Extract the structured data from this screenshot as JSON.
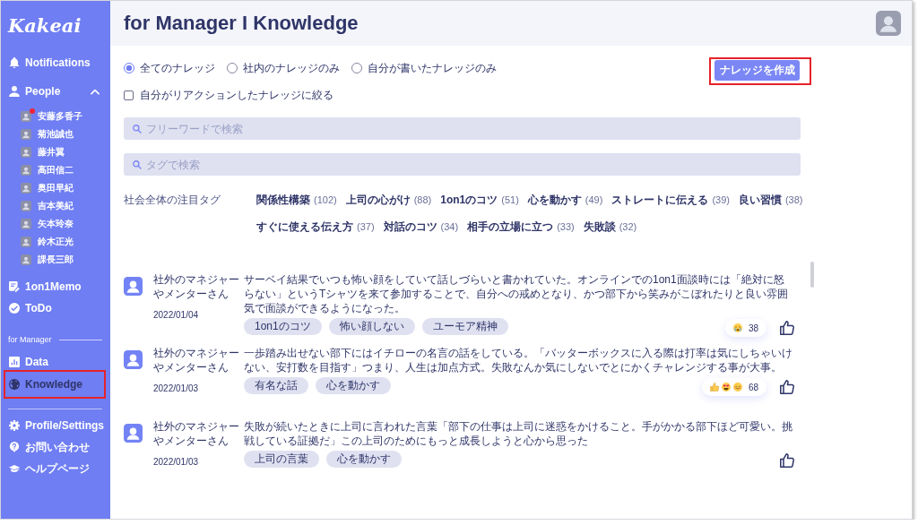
{
  "sidebar": {
    "logo": "Kakeai",
    "nav": [
      {
        "label": "Notifications",
        "selected": false
      }
    ],
    "people": {
      "label": "People",
      "expanded": true,
      "members": [
        {
          "name": "安藤多香子",
          "unread": true
        },
        {
          "name": "菊池誠也",
          "unread": false
        },
        {
          "name": "藤井翼",
          "unread": false
        },
        {
          "name": "高田信二",
          "unread": false
        },
        {
          "name": "奥田早紀",
          "unread": false
        },
        {
          "name": "吉本美紀",
          "unread": false
        },
        {
          "name": "矢本玲奈",
          "unread": false
        },
        {
          "name": "鈴木正光",
          "unread": false
        },
        {
          "name": "課長三郎",
          "unread": false
        }
      ]
    },
    "nav_after": [
      {
        "label": "1on1Memo",
        "selected": false
      },
      {
        "label": "ToDo",
        "selected": false
      }
    ],
    "manager_section": {
      "title": "for Manager",
      "items": [
        {
          "label": "Data",
          "selected": false,
          "annotated": false
        },
        {
          "label": "Knowledge",
          "selected": true,
          "annotated": true
        }
      ]
    },
    "footer_nav": [
      {
        "label": "Profile/Settings",
        "selected": false
      },
      {
        "label": "お問い合わせ",
        "selected": false
      },
      {
        "label": "ヘルプページ",
        "selected": false
      }
    ]
  },
  "header": {
    "title": "for Manager I Knowledge"
  },
  "filters": {
    "scope": [
      {
        "label": "全てのナレッジ",
        "selected": true
      },
      {
        "label": "社内のナレッジのみ",
        "selected": false
      },
      {
        "label": "自分が書いたナレッジのみ",
        "selected": false
      }
    ],
    "reacted_only": {
      "label": "自分がリアクションしたナレッジに絞る",
      "checked": false
    }
  },
  "create_button": {
    "label": "ナレッジを作成",
    "annotated": true
  },
  "search_fields": [
    {
      "placeholder": "フリーワードで検索"
    },
    {
      "placeholder": "タグで検索"
    }
  ],
  "trending_tags": {
    "label": "社会全体の注目タグ",
    "tags": [
      {
        "name": "関係性構築",
        "count": "(102)"
      },
      {
        "name": "上司の心がけ",
        "count": "(88)"
      },
      {
        "name": "1on1のコツ",
        "count": "(51)"
      },
      {
        "name": "心を動かす",
        "count": "(49)"
      },
      {
        "name": "ストレートに伝える",
        "count": "(39)"
      },
      {
        "name": "良い習慣",
        "count": "(38)"
      },
      {
        "name": "すぐに使える伝え方",
        "count": "(37)"
      },
      {
        "name": "対話のコツ",
        "count": "(34)"
      },
      {
        "name": "相手の立場に立つ",
        "count": "(33)"
      },
      {
        "name": "失敗談",
        "count": "(32)"
      }
    ]
  },
  "knowledge_list": [
    {
      "author": "社外のマネジャーやメンターさん",
      "date": "2022/01/04",
      "text": "サーベイ結果でいつも怖い顔をしていて話しづらいと書かれていた。オンラインでの1on1面談時には「絶対に怒らない」というTシャツを来て参加することで、自分への戒めとなり、かつ部下から笑みがこぼれたりと良い雰囲気で面談ができるようになった。",
      "tags": [
        "1on1のコツ",
        "怖い顔しない",
        "ユーモア精神"
      ],
      "reactions": {
        "emojis": [
          {
            "kind": "crying"
          }
        ],
        "count": "38"
      },
      "liked": false
    },
    {
      "author": "社外のマネジャーやメンターさん",
      "date": "2022/01/03",
      "text": "一歩踏み出せない部下にはイチローの名言の話をしている。「バッターボックスに入る際は打率は気にしちゃいけない、安打数を目指す」つまり、人生は加点方式。失敗なんか気にしないでとにかくチャレンジする事が大事。",
      "tags": [
        "有名な話",
        "心を動かす"
      ],
      "reactions": {
        "emojis": [
          {
            "kind": "thumbs-up"
          },
          {
            "kind": "heart-eyes"
          },
          {
            "kind": "smile"
          }
        ],
        "count": "68"
      },
      "liked": false
    },
    {
      "author": "社外のマネジャーやメンターさん",
      "date": "2022/01/03",
      "text": "失敗が続いたときに上司に言われた言葉「部下の仕事は上司に迷惑をかけること。手がかかる部下ほど可愛い。挑戦している証拠だ」この上司のためにもっと成長しようと心から思った",
      "tags": [
        "上司の言葉",
        "心を動かす"
      ],
      "liked": false
    }
  ]
}
